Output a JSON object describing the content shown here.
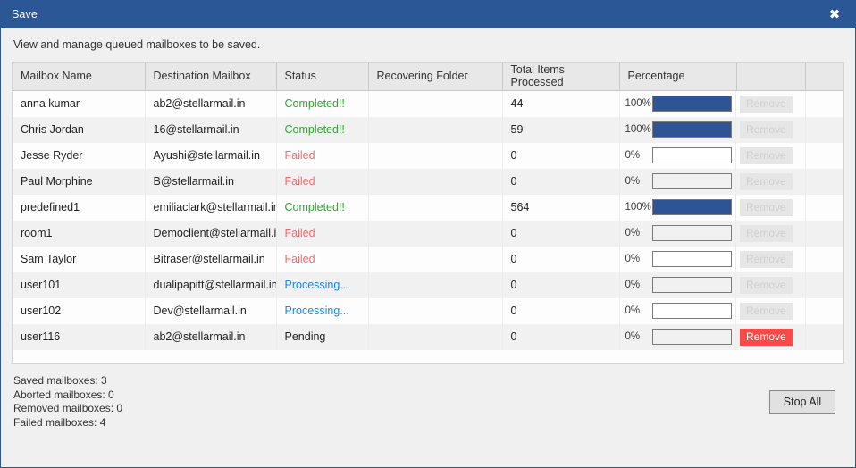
{
  "window": {
    "title": "Save",
    "close_icon": "close-icon",
    "instruction": "View and manage queued mailboxes to be saved."
  },
  "table": {
    "columns": [
      "Mailbox Name",
      "Destination Mailbox",
      "Status",
      "Recovering Folder",
      "Total Items Processed",
      "Percentage",
      "",
      ""
    ],
    "rows": [
      {
        "mailbox_name": "anna kumar",
        "destination_mailbox": "ab2@stellarmail.in",
        "status": "Completed!!",
        "status_kind": "completed",
        "recovering_folder": "",
        "total_items_processed": "44",
        "percentage_label": "100%",
        "percentage_value": 100,
        "remove_label": "Remove",
        "remove_enabled": false
      },
      {
        "mailbox_name": "Chris Jordan",
        "destination_mailbox": "16@stellarmail.in",
        "status": "Completed!!",
        "status_kind": "completed",
        "recovering_folder": "",
        "total_items_processed": "59",
        "percentage_label": "100%",
        "percentage_value": 100,
        "remove_label": "Remove",
        "remove_enabled": false
      },
      {
        "mailbox_name": "Jesse Ryder",
        "destination_mailbox": "Ayushi@stellarmail.in",
        "status": "Failed",
        "status_kind": "failed",
        "recovering_folder": "",
        "total_items_processed": "0",
        "percentage_label": "0%",
        "percentage_value": 0,
        "remove_label": "Remove",
        "remove_enabled": false
      },
      {
        "mailbox_name": "Paul Morphine",
        "destination_mailbox": "B@stellarmail.in",
        "status": "Failed",
        "status_kind": "failed",
        "recovering_folder": "",
        "total_items_processed": "0",
        "percentage_label": "0%",
        "percentage_value": 0,
        "remove_label": "Remove",
        "remove_enabled": false
      },
      {
        "mailbox_name": "predefined1",
        "destination_mailbox": "emiliaclark@stellarmail.in",
        "status": "Completed!!",
        "status_kind": "completed",
        "recovering_folder": "",
        "total_items_processed": "564",
        "percentage_label": "100%",
        "percentage_value": 100,
        "remove_label": "Remove",
        "remove_enabled": false
      },
      {
        "mailbox_name": "room1",
        "destination_mailbox": "Democlient@stellarmail.in",
        "status": "Failed",
        "status_kind": "failed",
        "recovering_folder": "",
        "total_items_processed": "0",
        "percentage_label": "0%",
        "percentage_value": 0,
        "remove_label": "Remove",
        "remove_enabled": false
      },
      {
        "mailbox_name": "Sam Taylor",
        "destination_mailbox": "Bitraser@stellarmail.in",
        "status": "Failed",
        "status_kind": "failed",
        "recovering_folder": "",
        "total_items_processed": "0",
        "percentage_label": "0%",
        "percentage_value": 0,
        "remove_label": "Remove",
        "remove_enabled": false
      },
      {
        "mailbox_name": "user101",
        "destination_mailbox": "dualipapitt@stellarmail.in",
        "status": "Processing...",
        "status_kind": "processing",
        "recovering_folder": "",
        "total_items_processed": "0",
        "percentage_label": "0%",
        "percentage_value": 0,
        "remove_label": "Remove",
        "remove_enabled": false
      },
      {
        "mailbox_name": "user102",
        "destination_mailbox": "Dev@stellarmail.in",
        "status": "Processing...",
        "status_kind": "processing",
        "recovering_folder": "",
        "total_items_processed": "0",
        "percentage_label": "0%",
        "percentage_value": 0,
        "remove_label": "Remove",
        "remove_enabled": false
      },
      {
        "mailbox_name": "user116",
        "destination_mailbox": "ab2@stellarmail.in",
        "status": "Pending",
        "status_kind": "pending",
        "recovering_folder": "",
        "total_items_processed": "0",
        "percentage_label": "0%",
        "percentage_value": 0,
        "remove_label": "Remove",
        "remove_enabled": true
      }
    ]
  },
  "footer": {
    "saved_mailboxes": "Saved mailboxes: 3",
    "aborted_mailboxes": "Aborted mailboxes: 0",
    "removed_mailboxes": "Removed mailboxes: 0",
    "failed_mailboxes": "Failed mailboxes: 4",
    "stop_all_label": "Stop All"
  },
  "colors": {
    "titlebar": "#2b5797",
    "progress_fill": "#2e5496",
    "status_completed": "#2fa82f",
    "status_failed": "#fb6b6b",
    "status_processing": "#1c86e8",
    "remove_active": "#f94a4a"
  }
}
